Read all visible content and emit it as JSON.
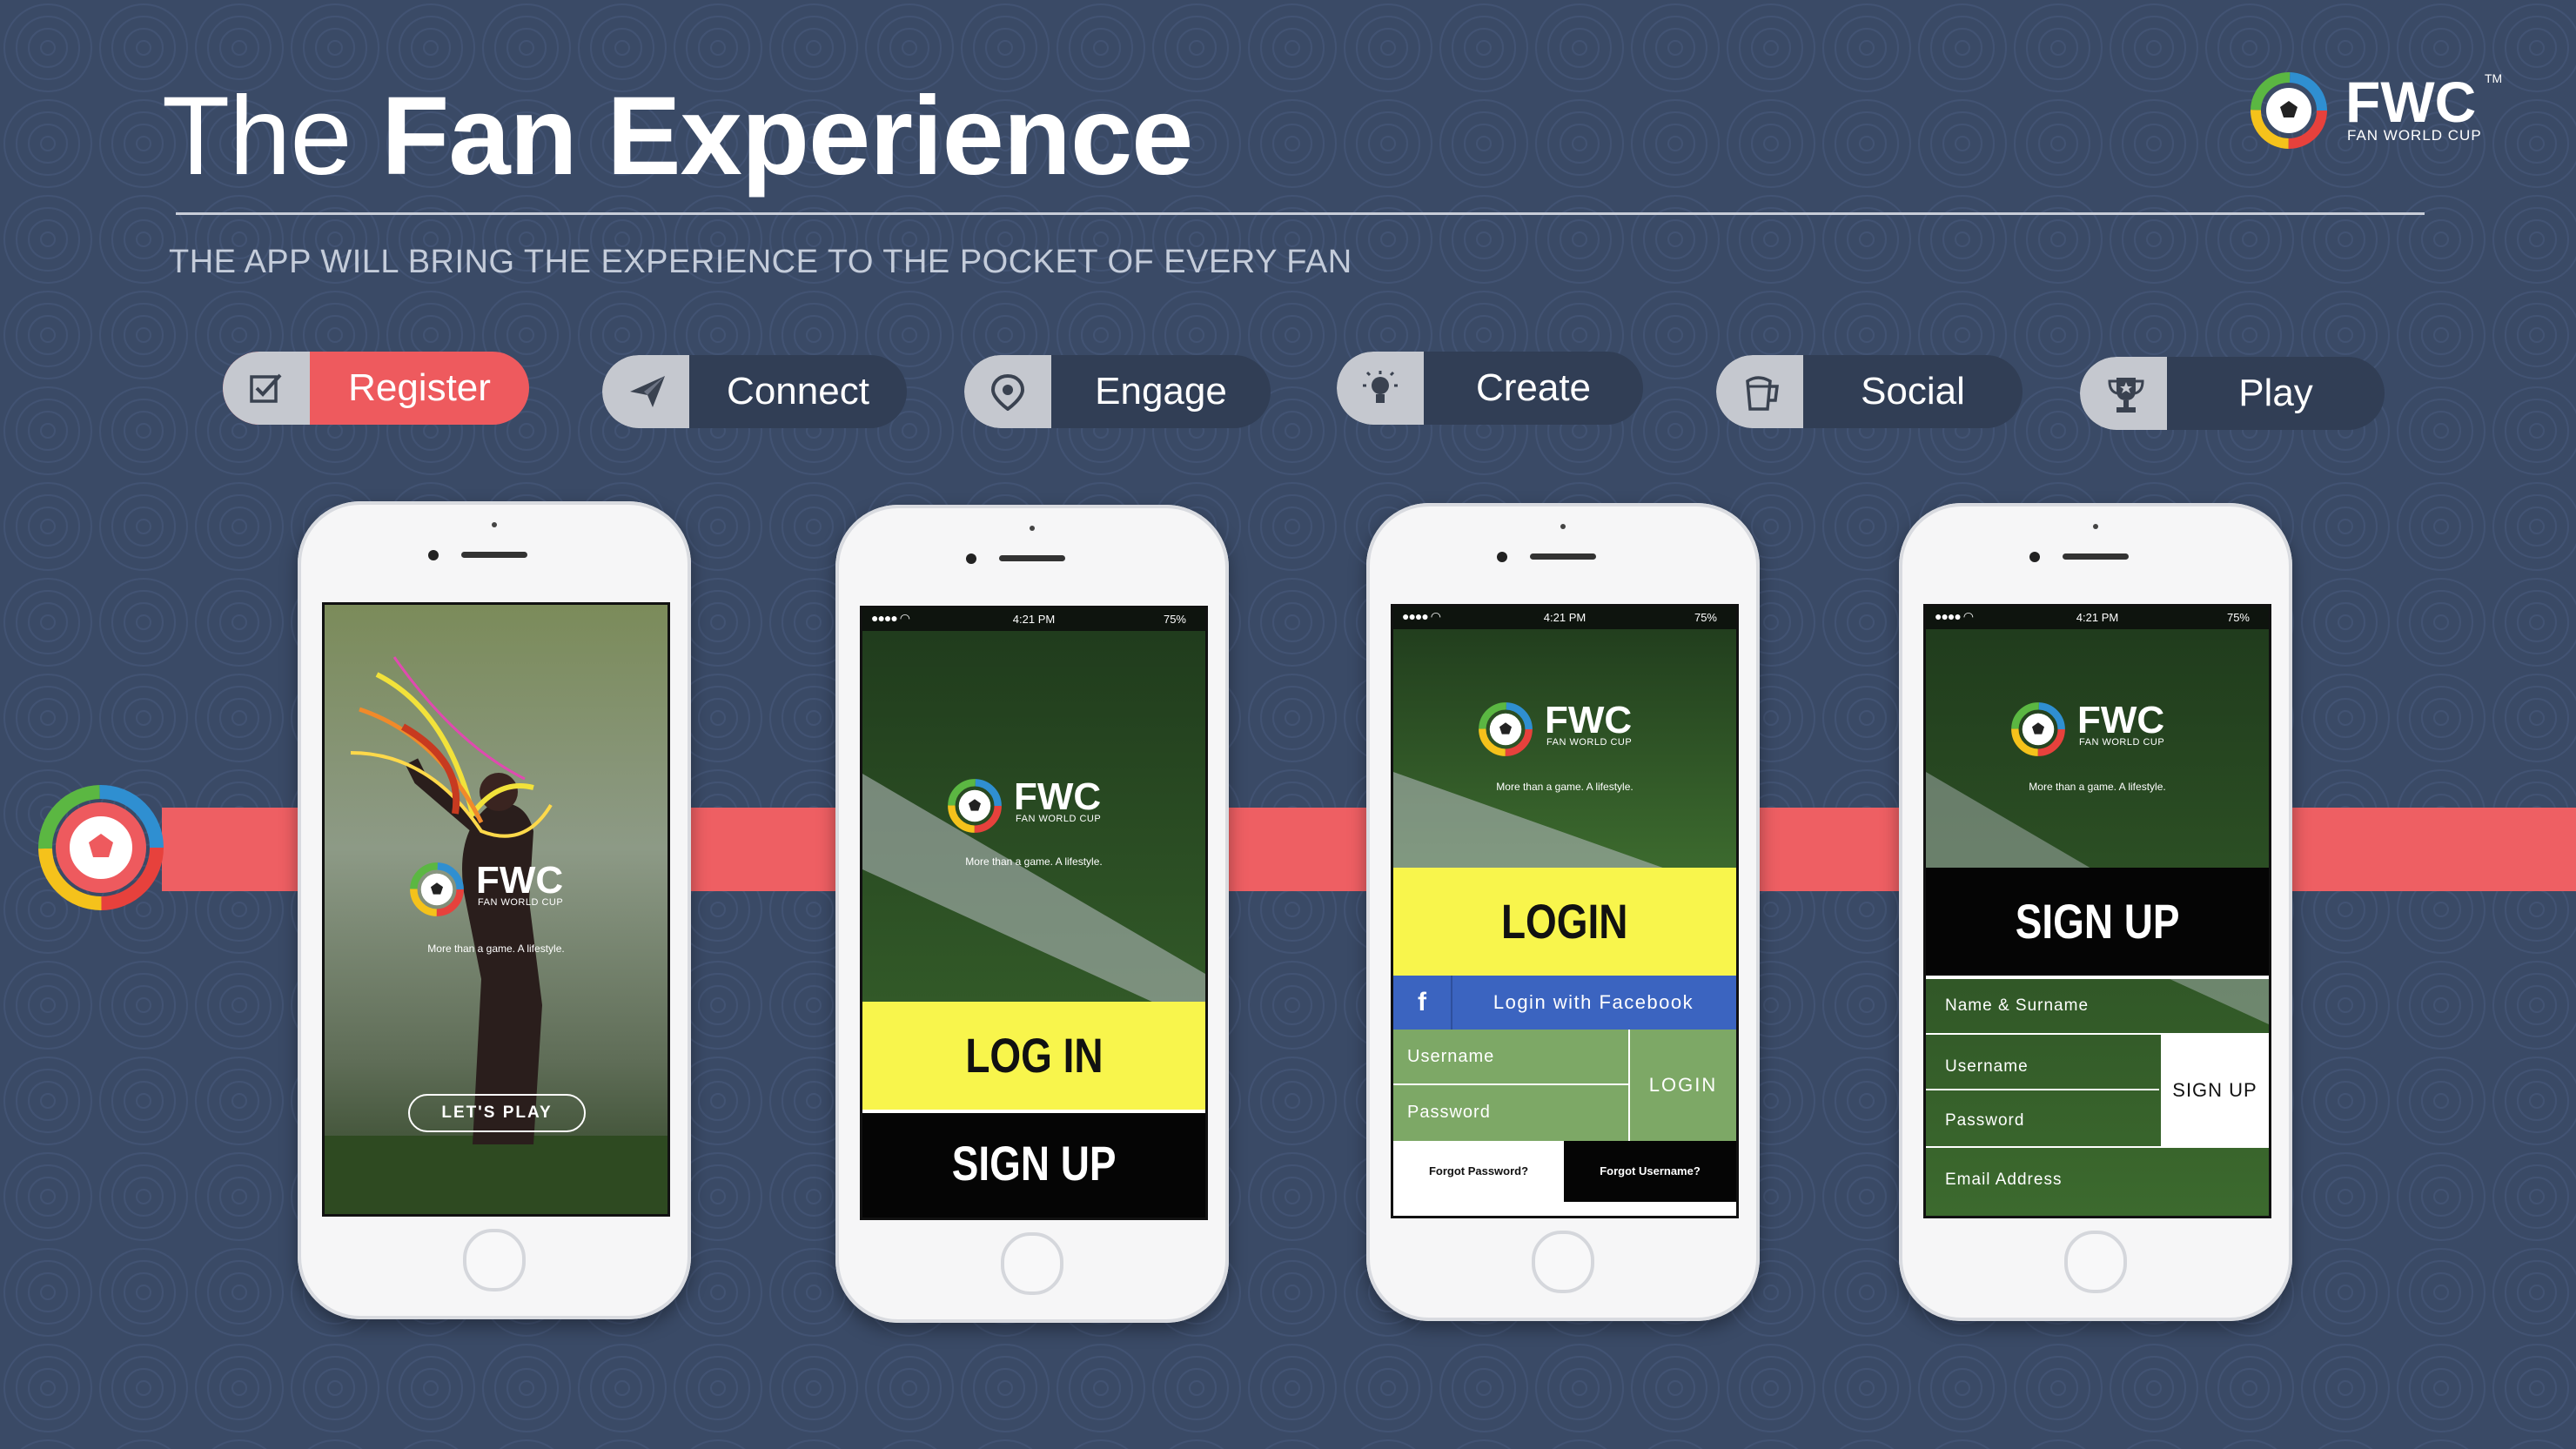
{
  "header": {
    "title_light": "The ",
    "title_bold": "Fan Experience",
    "subtitle": "THE APP WILL BRING THE EXPERIENCE TO THE POCKET OF EVERY FAN"
  },
  "brand": {
    "name": "FWC",
    "tm": "TM",
    "sub": "FAN WORLD CUP"
  },
  "features": [
    {
      "label": "Register",
      "icon": "checkbox-icon",
      "active": true
    },
    {
      "label": "Connect",
      "icon": "paper-plane-icon"
    },
    {
      "label": "Engage",
      "icon": "location-pin-icon"
    },
    {
      "label": "Create",
      "icon": "lightbulb-icon"
    },
    {
      "label": "Social",
      "icon": "beer-mug-icon"
    },
    {
      "label": "Play",
      "icon": "trophy-icon"
    }
  ],
  "colors": {
    "background": "#3a4a66",
    "accent": "#ee5a5e",
    "yellow": "#f8f54c",
    "facebook": "#3b64c0",
    "form_green": "#7da866"
  },
  "phones": {
    "status": {
      "time": "4:21 PM",
      "battery": "75%"
    },
    "logo": {
      "name": "FWC",
      "sub": "FAN WORLD CUP",
      "tagline": "More than a game. A lifestyle."
    },
    "p1": {
      "cta": "LET'S PLAY"
    },
    "p2": {
      "login": "LOG IN",
      "signup": "SIGN UP"
    },
    "p3": {
      "title": "LOGIN",
      "facebook": "Login with Facebook",
      "username": "Username",
      "password": "Password",
      "submit": "LOGIN",
      "forgot_password": "Forgot Password?",
      "forgot_username": "Forgot Username?"
    },
    "p4": {
      "title": "SIGN UP",
      "name": "Name & Surname",
      "username": "Username",
      "password": "Password",
      "submit": "SIGN UP",
      "email": "Email Address"
    }
  }
}
